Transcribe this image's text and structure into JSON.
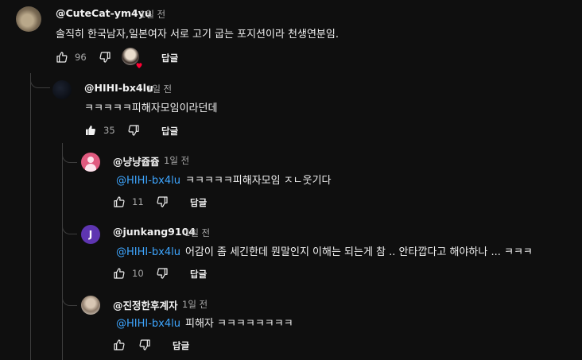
{
  "comments": [
    {
      "author": "@CuteCat-ym4yu",
      "time": "1일 전",
      "text": "솔직히 한국남자,일본여자 서로 고기 굽는 포지션이라 천생연분임.",
      "likes": "96",
      "reply_label": "답글",
      "avatar_icon": "cat-photo-avatar"
    }
  ],
  "replies": [
    {
      "author": "@HIHI-bx4lu",
      "time": "1일 전",
      "text": "ㅋㅋㅋㅋㅋ피해자모임이라던데",
      "likes": "35",
      "reply_label": "답글"
    },
    {
      "author": "@냥냥쥽쥽",
      "time": "1일 전",
      "mention": "@HIHI-bx4lu",
      "text": "ㅋㅋㅋㅋㅋ피해자모임 ㅈㄴ웃기다",
      "likes": "11",
      "reply_label": "답글"
    },
    {
      "author": "@junkang9104",
      "time": "1일 전",
      "avatar_letter": "J",
      "mention": "@HIHI-bx4lu",
      "text": "어감이 좀 세긴한데 뭔말인지 이해는 되는게 참 .. 안타깝다고 해야하나 ... ㅋㅋㅋ",
      "likes": "10",
      "reply_label": "답글"
    },
    {
      "author": "@진정한후계자",
      "time": "1일 전",
      "mention": "@HIHI-bx4lu",
      "text": "피해자 ㅋㅋㅋㅋㅋㅋㅋㅋ",
      "likes": "",
      "reply_label": "답글"
    }
  ],
  "colors": {
    "background": "#0f0f0f",
    "mention": "#3ea6ff",
    "heart": "#ff0033",
    "muted": "#aaaaaa"
  }
}
